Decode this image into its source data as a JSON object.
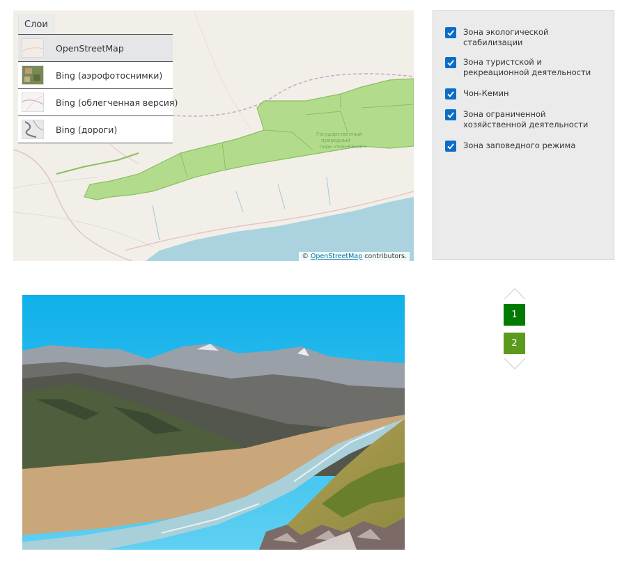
{
  "map": {
    "layers_title": "Слои",
    "layers": [
      {
        "label": "OpenStreetMap",
        "selected": true
      },
      {
        "label": "Bing (аэрофотоснимки)",
        "selected": false
      },
      {
        "label": "Bing (облегченная версия)",
        "selected": false
      },
      {
        "label": "Bing (дороги)",
        "selected": false
      }
    ],
    "attribution_prefix": "©",
    "attribution_link": "OpenStreetMap",
    "attribution_suffix": "contributors."
  },
  "legend": {
    "items": [
      {
        "label": "Зона экологической стабилизации",
        "checked": true
      },
      {
        "label": "Зона туристской и рекреационной деятельности",
        "checked": true
      },
      {
        "label": "Чон-Кемин",
        "checked": true
      },
      {
        "label": "Зона ограниченной хозяйственной деятельности",
        "checked": true
      },
      {
        "label": "Зона заповедного режима",
        "checked": true
      }
    ]
  },
  "pager": {
    "pages": [
      "1",
      "2"
    ],
    "current": "1"
  },
  "colors": {
    "checkbox": "#0b6ec6",
    "page_active": "#007a00",
    "page_inactive": "#5b9a1c",
    "park_fill": "#b2dc8b",
    "water": "#aad3df"
  }
}
